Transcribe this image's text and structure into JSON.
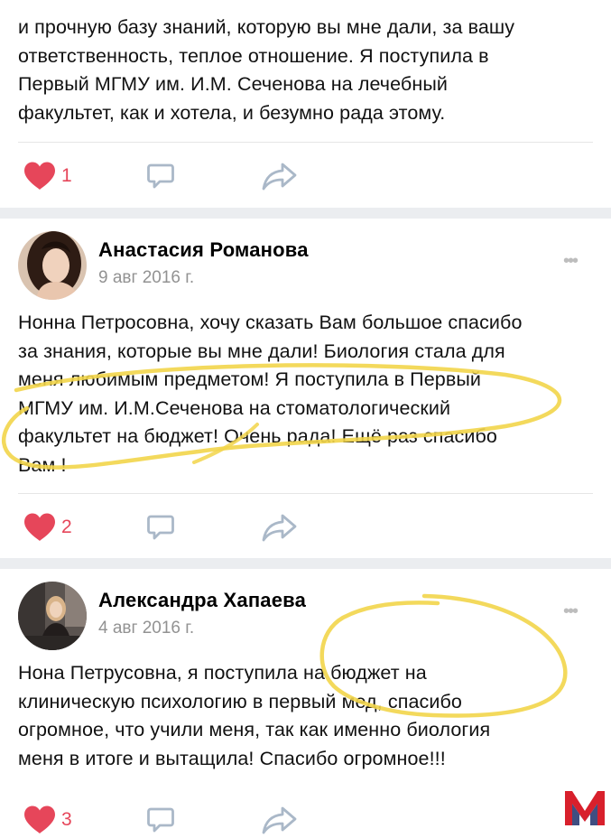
{
  "posts": [
    {
      "text_lines": [
        "и прочную базу знаний, которую вы мне дали, за вашу",
        "ответственность, теплое отношение. Я поступила в",
        "Первый МГМУ им. И.М. Сеченова на лечебный",
        "факультет, как и хотела, и безумно рада этому."
      ],
      "likes": "1"
    },
    {
      "author": "Анастасия Романова",
      "date": "9 авг 2016 г.",
      "text_lines": [
        "Нонна Петросовна, хочу сказать Вам большое спасибо",
        "за знания, которые вы мне дали! Биология стала для",
        "меня любимым предметом! Я поступила в Первый",
        "МГМУ им. И.М.Сеченова на стоматологический",
        "факультет на бюджет! Очень рада! Ещё раз спасибо",
        "Вам !"
      ],
      "likes": "2"
    },
    {
      "author": "Александра Хапаева",
      "date": "4 авг 2016 г.",
      "text_lines": [
        "Нона Петрусовна, я поступила на бюджет на",
        "клиническую психологию в первый мед, спасибо",
        "огромное, что учили меня, так как именно биология",
        "меня в итоге и вытащила! Спасибо огромное!!!"
      ],
      "likes": "3"
    }
  ],
  "more_glyph": "•••",
  "colors": {
    "like_red": "#e6465a",
    "icon_blue": "#aab8c8",
    "highlight_yellow": "#f2d54a",
    "separator": "#ebedf0",
    "logo_red": "#d8202c",
    "logo_blue": "#1f2f6b"
  },
  "icons": [
    "heart-icon",
    "comment-icon",
    "share-icon",
    "more-icon",
    "logo-mark"
  ]
}
